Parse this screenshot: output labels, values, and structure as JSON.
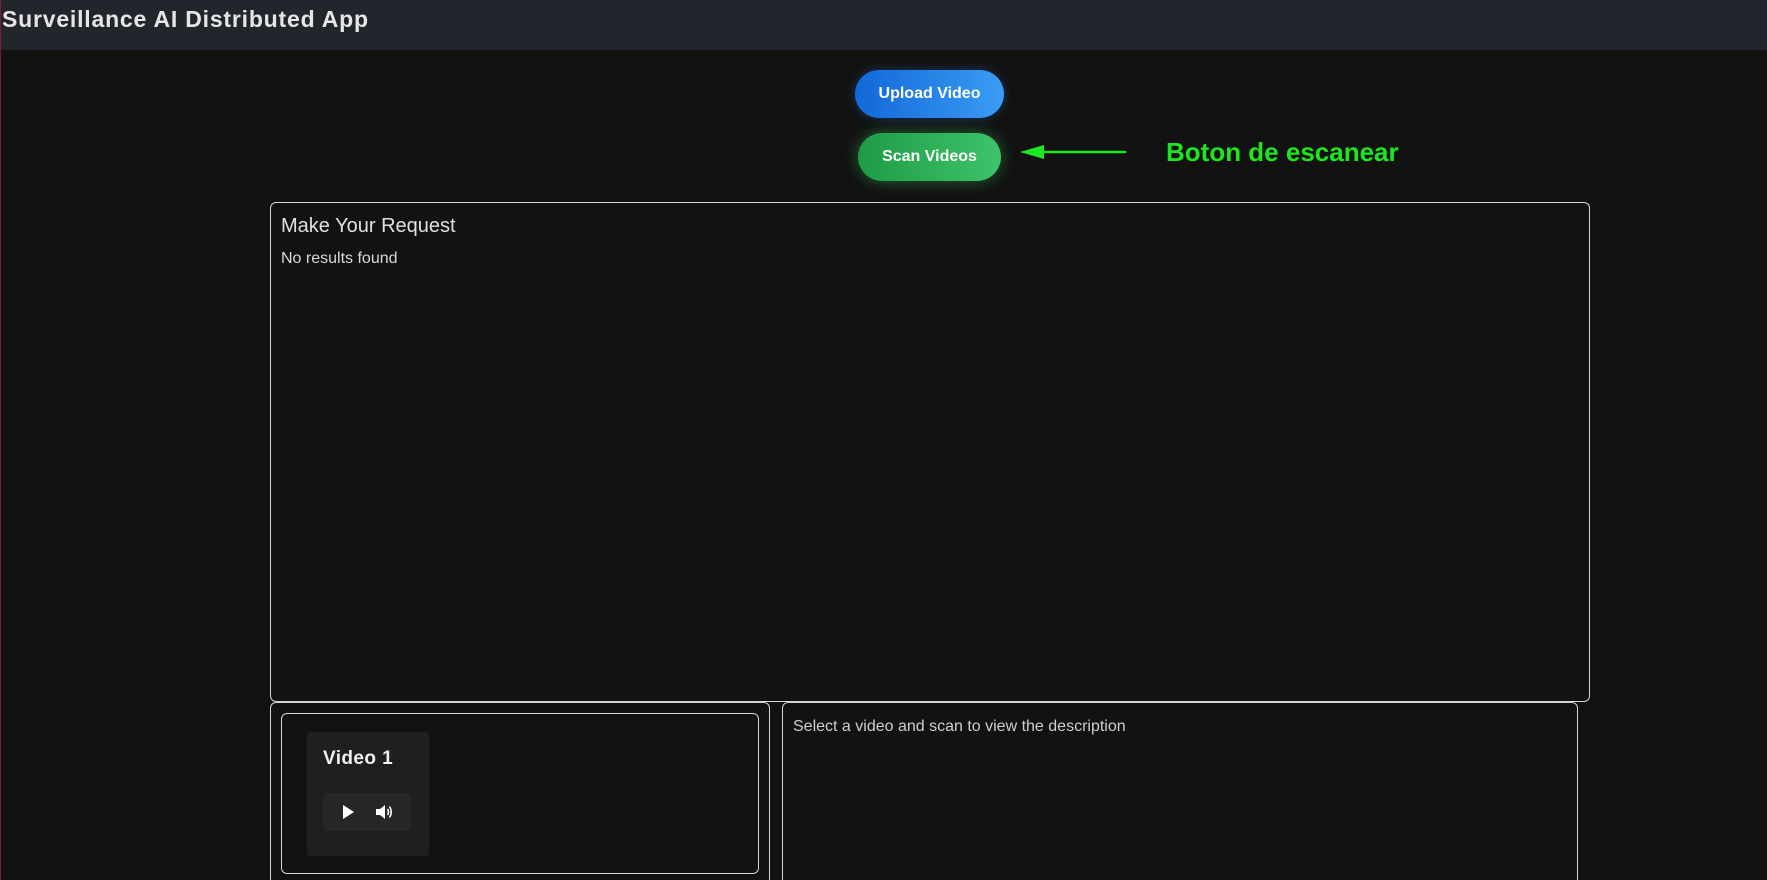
{
  "header": {
    "title": "Surveillance AI Distributed App"
  },
  "actions": {
    "upload_label": "Upload Video",
    "scan_label": "Scan Videos"
  },
  "annotation": {
    "label": "Boton de escanear",
    "color": "#1ee61e"
  },
  "request_panel": {
    "title": "Make Your Request",
    "status": "No results found"
  },
  "videos": {
    "items": [
      {
        "title": "Video 1",
        "controls": [
          "play-icon",
          "volume-icon"
        ]
      }
    ]
  },
  "description_panel": {
    "placeholder": "Select a video and scan to view the description"
  },
  "colors": {
    "background": "#121212",
    "header": "#22252b",
    "upload_button": "#2a86ea",
    "scan_button": "#2fb259",
    "border": "#d4d4d4"
  }
}
